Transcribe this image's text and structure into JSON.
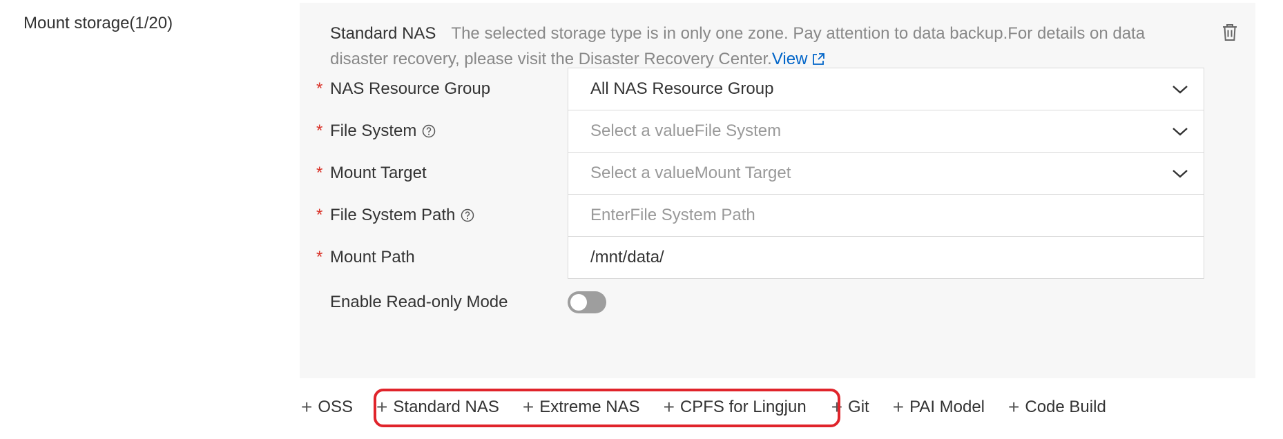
{
  "section": {
    "label": "Mount storage(1/20)"
  },
  "panel": {
    "title": "Standard NAS",
    "notice": "The selected storage type is in only one zone. Pay attention to data backup.For details on data disaster recovery, please visit the Disaster Recovery Center.",
    "view_link": "View",
    "delete_icon": "trash-icon"
  },
  "form": {
    "required_mark": "*",
    "resource_group": {
      "label": "NAS Resource Group",
      "value": "All NAS Resource Group"
    },
    "file_system": {
      "label": "File System",
      "placeholder": "Select a valueFile System"
    },
    "mount_target": {
      "label": "Mount Target",
      "placeholder": "Select a valueMount Target"
    },
    "file_system_path": {
      "label": "File System Path",
      "placeholder": "EnterFile System Path"
    },
    "mount_path": {
      "label": "Mount Path",
      "value": "/mnt/data/"
    },
    "read_only": {
      "label": "Enable Read-only Mode",
      "enabled": false
    }
  },
  "add_storage": {
    "plus": "+",
    "items": [
      "OSS",
      "Standard NAS",
      "Extreme NAS",
      "CPFS for Lingjun",
      "Git",
      "PAI Model",
      "Code Build"
    ],
    "highlighted": [
      "Standard NAS",
      "Extreme NAS",
      "CPFS for Lingjun"
    ]
  },
  "colors": {
    "link": "#0064c8",
    "required": "#d93026",
    "highlight_border": "#e0242b",
    "panel_bg": "#f7f7f7",
    "toggle_off": "#9e9e9e"
  }
}
